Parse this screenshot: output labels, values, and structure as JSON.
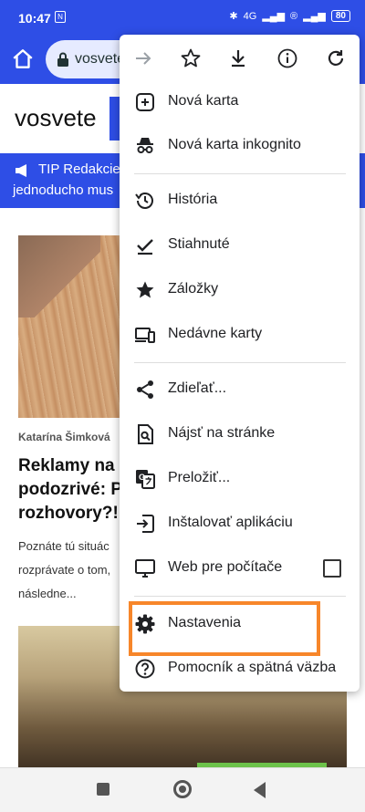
{
  "status_bar": {
    "time": "10:47",
    "network": "4G",
    "battery": "80"
  },
  "toolbar": {
    "url": "vosvete"
  },
  "page": {
    "site_name": "vosvete",
    "tip_line1": "TIP Redakcie",
    "tip_line2": "jednoducho mus",
    "author": "Katarína Šimková",
    "headline_line1": "Reklamy na m",
    "headline_line2": "podozrivé: Po",
    "headline_line3": "rozhovory?!",
    "excerpt_line1": "Poznáte tú situác",
    "excerpt_line2": "rozprávate o tom,",
    "excerpt_line3": "následne..."
  },
  "menu": {
    "items": [
      {
        "label": "Nová karta",
        "icon": "new-tab-icon"
      },
      {
        "label": "Nová karta inkognito",
        "icon": "incognito-icon"
      },
      {
        "label": "História",
        "icon": "history-icon"
      },
      {
        "label": "Stiahnuté",
        "icon": "downloads-icon"
      },
      {
        "label": "Záložky",
        "icon": "star-icon"
      },
      {
        "label": "Nedávne karty",
        "icon": "devices-icon"
      },
      {
        "label": "Zdieľať...",
        "icon": "share-icon"
      },
      {
        "label": "Nájsť na stránke",
        "icon": "find-in-page-icon"
      },
      {
        "label": "Preložiť...",
        "icon": "translate-icon"
      },
      {
        "label": "Inštalovať aplikáciu",
        "icon": "install-app-icon"
      },
      {
        "label": "Web pre počítače",
        "icon": "desktop-icon"
      },
      {
        "label": "Nastavenia",
        "icon": "gear-icon"
      },
      {
        "label": "Pomocník a spätná väzba",
        "icon": "help-icon"
      }
    ]
  },
  "colors": {
    "brand_blue": "#2e4ee6",
    "highlight": "#f7862a"
  }
}
